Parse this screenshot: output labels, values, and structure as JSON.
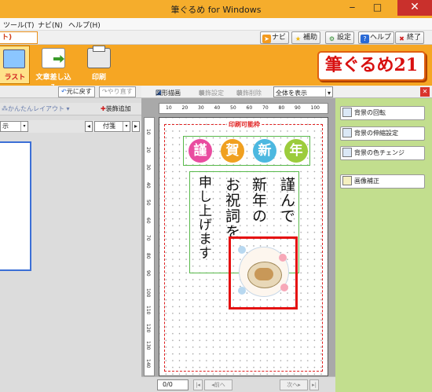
{
  "window": {
    "title": "筆ぐるめ for Windows",
    "minimize": "‒",
    "maximize": "□",
    "close": "✕"
  },
  "menu": {
    "tools": "ツール(T)",
    "navi": "ナビ(N)",
    "help": "ヘルプ(H)"
  },
  "toolbar2": {
    "selected_tab": "ト)",
    "buttons": [
      {
        "label": "ナビ",
        "icon": "navi-icon"
      },
      {
        "label": "補助",
        "icon": "star-icon"
      },
      {
        "label": "設定",
        "icon": "settings-icon"
      },
      {
        "label": "ヘルプ",
        "icon": "help-icon"
      },
      {
        "label": "終了",
        "icon": "exit-icon"
      }
    ]
  },
  "ribbon": {
    "illust_label": "ラスト",
    "text_import_label": "文章差し込み",
    "print_label": "印刷",
    "logo_text": "筆ぐるめ21"
  },
  "left_panel": {
    "undo_label": "元に戻す",
    "redo_label": "やり直す",
    "easy_layout_label": "かんたんレイアウト",
    "add_decoration_label": "装飾追加",
    "view_dropdown": "示",
    "category_dropdown": "付箋"
  },
  "center_toolbar": {
    "draw_shape": "図形描画",
    "decoration_setting": "装飾設定",
    "decoration_delete": "装飾削除",
    "zoom_select": "全体を表示"
  },
  "ruler": {
    "h_ticks": [
      "10",
      "20",
      "30",
      "40",
      "50",
      "60",
      "70",
      "80",
      "90",
      "100"
    ],
    "v_ticks": [
      "10",
      "20",
      "30",
      "40",
      "50",
      "60",
      "70",
      "80",
      "90",
      "100",
      "110",
      "120",
      "130",
      "140"
    ]
  },
  "canvas": {
    "print_area_label": "印刷可能枠",
    "stamps": [
      {
        "char": "謹",
        "color": "#e94ca0"
      },
      {
        "char": "賀",
        "color": "#f0a020"
      },
      {
        "char": "新",
        "color": "#4cb8e0"
      },
      {
        "char": "年",
        "color": "#9ccc3c"
      }
    ],
    "greeting_columns": [
      "謹んで",
      "新年の",
      "お祝詞を",
      "申し上げます"
    ]
  },
  "bottom": {
    "page_indicator": "0/0",
    "prev_label": "前へ",
    "next_label": "次へ"
  },
  "right_panel": {
    "buttons": [
      "背景の回転",
      "背景の伸縮設定",
      "背景の色チェンジ",
      "画像補正"
    ]
  }
}
